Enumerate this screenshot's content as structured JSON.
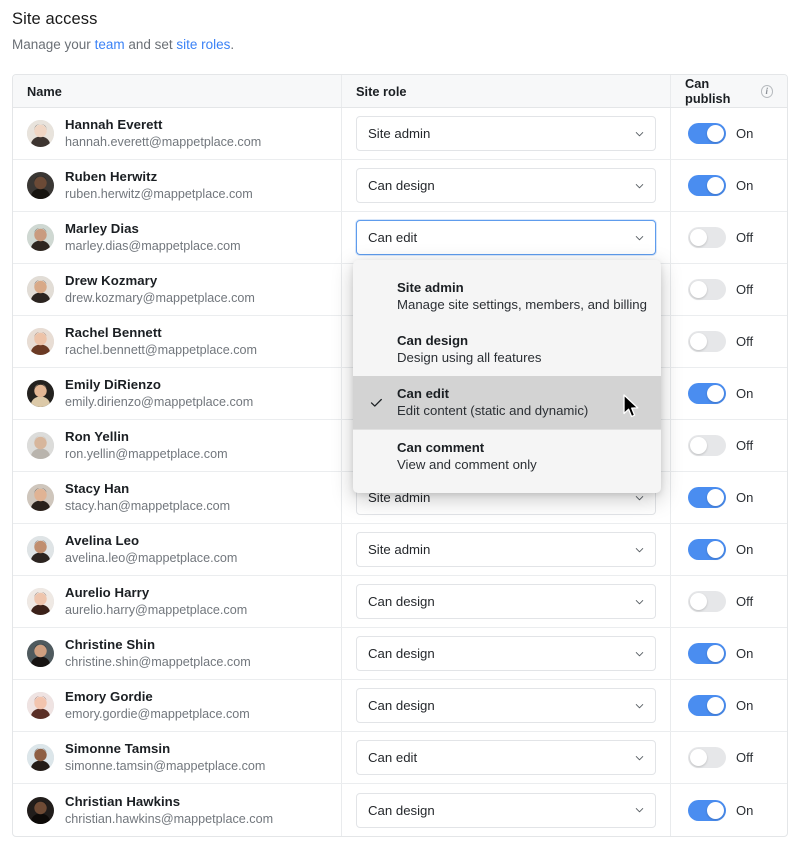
{
  "header": {
    "title": "Site access",
    "subtitle_prefix": "Manage your ",
    "link_team": "team",
    "subtitle_middle": " and set ",
    "link_site_roles": "site roles",
    "subtitle_suffix": "."
  },
  "table": {
    "columns": {
      "name": "Name",
      "site_role": "Site role",
      "can_publish": "Can publish"
    },
    "info_icon_glyph": "i",
    "rows": [
      {
        "name": "Hannah Everett",
        "email": "hannah.everett@mappetplace.com",
        "role": "Site admin",
        "publish": "On",
        "publish_on": true,
        "avatar": "avatar-hannah-everett",
        "focused": false
      },
      {
        "name": "Ruben Herwitz",
        "email": "ruben.herwitz@mappetplace.com",
        "role": "Can design",
        "publish": "On",
        "publish_on": true,
        "avatar": "avatar-ruben-herwitz",
        "focused": false
      },
      {
        "name": "Marley Dias",
        "email": "marley.dias@mappetplace.com",
        "role": "Can edit",
        "publish": "Off",
        "publish_on": false,
        "avatar": "avatar-marley-dias",
        "focused": true
      },
      {
        "name": "Drew Kozmary",
        "email": "drew.kozmary@mappetplace.com",
        "role": "",
        "publish": "Off",
        "publish_on": false,
        "avatar": "avatar-drew-kozmary",
        "focused": false
      },
      {
        "name": "Rachel Bennett",
        "email": "rachel.bennett@mappetplace.com",
        "role": "",
        "publish": "Off",
        "publish_on": false,
        "avatar": "avatar-rachel-bennett",
        "focused": false
      },
      {
        "name": "Emily DiRienzo",
        "email": "emily.dirienzo@mappetplace.com",
        "role": "",
        "publish": "On",
        "publish_on": true,
        "avatar": "avatar-emily-dirienzo",
        "focused": false
      },
      {
        "name": "Ron Yellin",
        "email": "ron.yellin@mappetplace.com",
        "role": "",
        "publish": "Off",
        "publish_on": false,
        "avatar": "avatar-ron-yellin",
        "focused": false
      },
      {
        "name": "Stacy Han",
        "email": "stacy.han@mappetplace.com",
        "role": "Site admin",
        "publish": "On",
        "publish_on": true,
        "avatar": "avatar-stacy-han",
        "focused": false
      },
      {
        "name": "Avelina Leo",
        "email": "avelina.leo@mappetplace.com",
        "role": "Site admin",
        "publish": "On",
        "publish_on": true,
        "avatar": "avatar-avelina-leo",
        "focused": false
      },
      {
        "name": "Aurelio Harry",
        "email": "aurelio.harry@mappetplace.com",
        "role": "Can design",
        "publish": "Off",
        "publish_on": false,
        "avatar": "avatar-aurelio-harry",
        "focused": false
      },
      {
        "name": "Christine Shin",
        "email": "christine.shin@mappetplace.com",
        "role": "Can design",
        "publish": "On",
        "publish_on": true,
        "avatar": "avatar-christine-shin",
        "focused": false
      },
      {
        "name": "Emory Gordie",
        "email": "emory.gordie@mappetplace.com",
        "role": "Can design",
        "publish": "On",
        "publish_on": true,
        "avatar": "avatar-emory-gordie",
        "focused": false
      },
      {
        "name": "Simonne Tamsin",
        "email": "simonne.tamsin@mappetplace.com",
        "role": "Can edit",
        "publish": "Off",
        "publish_on": false,
        "avatar": "avatar-simonne-tamsin",
        "focused": false
      },
      {
        "name": "Christian Hawkins",
        "email": "christian.hawkins@mappetplace.com",
        "role": "Can design",
        "publish": "On",
        "publish_on": true,
        "avatar": "avatar-christian-hawkins",
        "focused": false
      }
    ]
  },
  "role_menu": {
    "open_for_row": "Marley Dias",
    "options": [
      {
        "title": "Site admin",
        "description": "Manage site settings, members, and billing",
        "selected": false
      },
      {
        "title": "Can design",
        "description": "Design using all features",
        "selected": false
      },
      {
        "title": "Can edit",
        "description": "Edit content (static and dynamic)",
        "selected": true
      },
      {
        "title": "Can comment",
        "description": "View and comment only",
        "selected": false
      }
    ]
  },
  "colors": {
    "accent_blue": "#4a8df0",
    "link_blue": "#3b82f6",
    "focus_border": "#5e9ced",
    "toggle_off": "#e6e7e9",
    "header_bg": "#f7f8f9",
    "menu_bg": "#f5f5f5",
    "menu_selected_bg": "#d3d3d3",
    "text_primary": "#1b1f23",
    "text_muted": "#72777d"
  }
}
